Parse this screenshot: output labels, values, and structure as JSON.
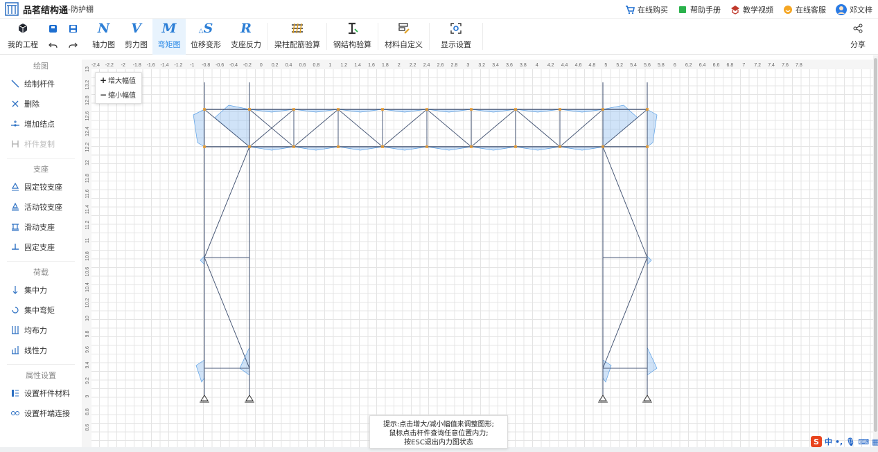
{
  "app": {
    "title": "品茗结构通",
    "subtitle": "-防护棚",
    "top_links": [
      "在线购买",
      "帮助手册",
      "教学视频",
      "在线客服"
    ],
    "user": "邓文梓"
  },
  "toolbar": {
    "my_project": "我的工程",
    "buttons": [
      {
        "glyph": "N",
        "label": "轴力图"
      },
      {
        "glyph": "V",
        "label": "剪力图"
      },
      {
        "glyph": "M",
        "label": "弯矩图"
      },
      {
        "glyph": "S",
        "label": "位移变形"
      },
      {
        "glyph": "R",
        "label": "支座反力"
      }
    ],
    "check_buttons": [
      "梁柱配筋验算",
      "钢结构验算",
      "材料自定义",
      "显示设置"
    ],
    "share": "分享",
    "active": "弯矩图"
  },
  "sidebar": {
    "sections": [
      {
        "head": "绘图",
        "items": [
          {
            "label": "绘制杆件",
            "icon": "line-draw-icon",
            "disabled": false
          },
          {
            "label": "删除",
            "icon": "delete-x-icon",
            "disabled": false
          },
          {
            "label": "增加结点",
            "icon": "add-node-icon",
            "disabled": false
          },
          {
            "label": "杆件复制",
            "icon": "copy-member-icon",
            "disabled": true
          }
        ]
      },
      {
        "head": "支座",
        "items": [
          {
            "label": "固定铰支座",
            "icon": "pin-support-icon",
            "disabled": false
          },
          {
            "label": "活动铰支座",
            "icon": "roller-support-icon",
            "disabled": false
          },
          {
            "label": "滑动支座",
            "icon": "slide-support-icon",
            "disabled": false
          },
          {
            "label": "固定支座",
            "icon": "fixed-support-icon",
            "disabled": false
          }
        ]
      },
      {
        "head": "荷载",
        "items": [
          {
            "label": "集中力",
            "icon": "point-load-icon",
            "disabled": false
          },
          {
            "label": "集中弯矩",
            "icon": "moment-load-icon",
            "disabled": false
          },
          {
            "label": "均布力",
            "icon": "uniform-load-icon",
            "disabled": false
          },
          {
            "label": "线性力",
            "icon": "linear-load-icon",
            "disabled": false
          }
        ]
      },
      {
        "head": "属性设置",
        "items": [
          {
            "label": "设置杆件材料",
            "icon": "material-icon",
            "disabled": false
          },
          {
            "label": "设置杆端连接",
            "icon": "connection-icon",
            "disabled": false
          }
        ]
      }
    ]
  },
  "zoom_menu": {
    "increase": "增大幅值",
    "decrease": "缩小幅值"
  },
  "hint": {
    "line1": "提示:点击增大/减小幅值来调整图形;",
    "line2": "鼠标点击杆件查询任意位置内力;",
    "line3": "按ESC退出内力图状态"
  },
  "ruler": {
    "x_ticks": [
      "-2.4",
      "-2.2",
      "-2",
      "-1.8",
      "-1.6",
      "-1.4",
      "-1.2",
      "-1",
      "-0.8",
      "-0.6",
      "-0.4",
      "-0.2",
      "0",
      "0.2",
      "0.4",
      "0.6",
      "0.8",
      "1",
      "1.2",
      "1.4",
      "1.6",
      "1.8",
      "2",
      "2.2",
      "2.4",
      "2.6",
      "2.8",
      "3",
      "3.2",
      "3.4",
      "3.6",
      "3.8",
      "4",
      "4.2",
      "4.4",
      "4.6",
      "4.8",
      "5",
      "5.2",
      "5.4",
      "5.6",
      "5.8",
      "6",
      "6.2",
      "6.4",
      "6.6",
      "6.8",
      "7",
      "7.2",
      "7.4",
      "7.6",
      "7.8"
    ],
    "y_ticks": [
      "13",
      "13.2",
      "12.8",
      "12.6",
      "12.4",
      "12.2",
      "12",
      "11.8",
      "11.6",
      "11.4",
      "11.2",
      "11",
      "10.8",
      "10.6",
      "10.4",
      "10.2",
      "10",
      "9.8",
      "9.6",
      "9.4",
      "9.2",
      "9",
      "8.8",
      "8.6"
    ]
  },
  "ime": {
    "label": "中"
  },
  "colors": {
    "accent": "#2b8ae6",
    "member": "#4a5a78",
    "diagram": "#5aa0e6",
    "support": "#f0a030"
  }
}
